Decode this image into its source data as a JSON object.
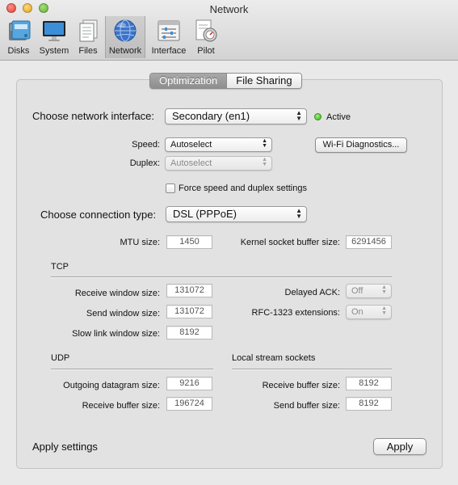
{
  "window": {
    "title": "Network"
  },
  "toolbar": {
    "items": [
      {
        "label": "Disks",
        "icon": "disks-icon"
      },
      {
        "label": "System",
        "icon": "monitor-icon"
      },
      {
        "label": "Files",
        "icon": "files-icon"
      },
      {
        "label": "Network",
        "icon": "globe-icon",
        "selected": true
      },
      {
        "label": "Interface",
        "icon": "interface-icon"
      },
      {
        "label": "Pilot",
        "icon": "pilot-icon"
      }
    ]
  },
  "tabs": [
    {
      "label": "Optimization",
      "active": true
    },
    {
      "label": "File Sharing",
      "active": false
    }
  ],
  "interface": {
    "label": "Choose network interface:",
    "value": "Secondary (en1)",
    "status": "Active",
    "status_color": "#3cb520"
  },
  "speed": {
    "label": "Speed:",
    "value": "Autoselect"
  },
  "duplex": {
    "label": "Duplex:",
    "value": "Autoselect"
  },
  "wifi_button": "Wi-Fi Diagnostics...",
  "force_checkbox": {
    "label": "Force speed and duplex settings",
    "checked": false
  },
  "connection": {
    "label": "Choose connection type:",
    "value": "DSL (PPPoE)"
  },
  "mtu": {
    "label": "MTU size:",
    "value": "1450"
  },
  "kernel_buffer": {
    "label": "Kernel socket buffer size:",
    "value": "6291456"
  },
  "tcp": {
    "header": "TCP",
    "receive_window": {
      "label": "Receive window size:",
      "value": "131072"
    },
    "send_window": {
      "label": "Send window size:",
      "value": "131072"
    },
    "slow_link": {
      "label": "Slow link window size:",
      "value": "8192"
    },
    "delayed_ack": {
      "label": "Delayed ACK:",
      "value": "Off"
    },
    "rfc1323": {
      "label": "RFC-1323 extensions:",
      "value": "On"
    }
  },
  "udp": {
    "header": "UDP",
    "outgoing": {
      "label": "Outgoing datagram size:",
      "value": "9216"
    },
    "receive": {
      "label": "Receive buffer size:",
      "value": "196724"
    }
  },
  "local_stream": {
    "header": "Local stream sockets",
    "receive": {
      "label": "Receive buffer size:",
      "value": "8192"
    },
    "send": {
      "label": "Send buffer size:",
      "value": "8192"
    }
  },
  "apply": {
    "label": "Apply settings",
    "button": "Apply"
  }
}
